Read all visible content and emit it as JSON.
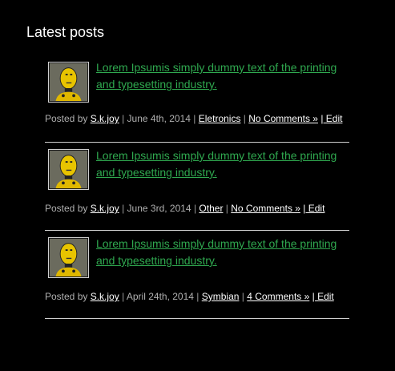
{
  "widget": {
    "title": "Latest posts"
  },
  "posts": [
    {
      "title": "Lorem Ipsumis simply dummy text of the printing and typesetting industry.",
      "posted_by_label": "Posted by",
      "author": "S.k.joy",
      "date": "June 4th, 2014",
      "category": "Eletronics",
      "comments": "No Comments »",
      "edit": "| Edit"
    },
    {
      "title": "Lorem Ipsumis simply dummy text of the printing and typesetting industry.",
      "posted_by_label": "Posted by",
      "author": "S.k.joy",
      "date": "June 3rd, 2014",
      "category": "Other",
      "comments": "No Comments »",
      "edit": "| Edit"
    },
    {
      "title": "Lorem Ipsumis simply dummy text of the printing and typesetting industry.",
      "posted_by_label": "Posted by",
      "author": "S.k.joy",
      "date": "April 24th, 2014",
      "category": "Symbian",
      "comments": "4 Comments »",
      "edit": "| Edit"
    }
  ],
  "separator": "|",
  "colors": {
    "background": "#000000",
    "title_link": "#2fa84f",
    "meta_text": "#b0b0b0",
    "meta_link": "#ffffff",
    "divider": "#cfcfcf"
  },
  "icons": {
    "thumbnail": "crash-test-dummy-thumbnail"
  }
}
